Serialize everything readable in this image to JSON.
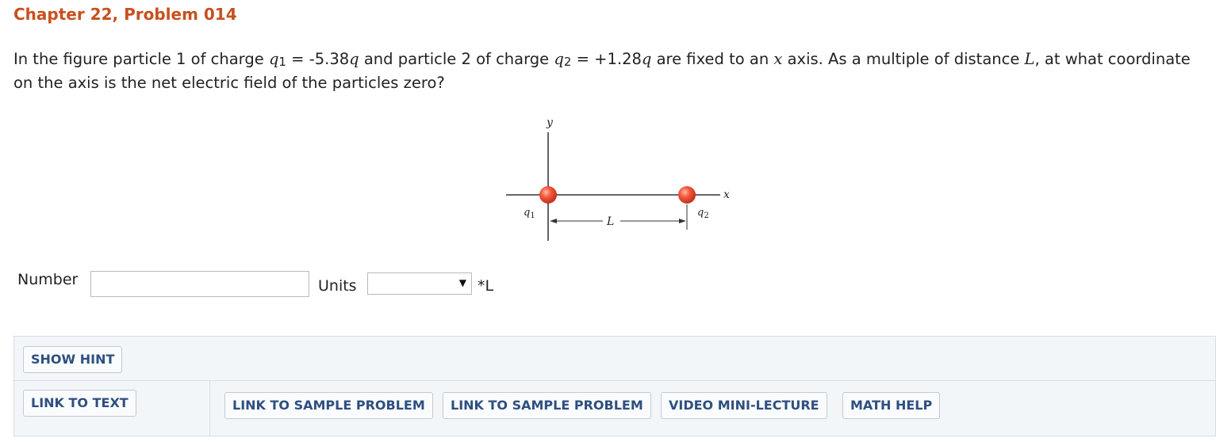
{
  "header": {
    "title": "Chapter 22, Problem 014"
  },
  "problem": {
    "part1": "In the figure particle 1 of charge ",
    "q1_var": "q",
    "q1_sub": "1",
    "q1_eq": " = -5.38",
    "q1_q": "q",
    "part2": " and particle 2 of charge ",
    "q2_var": "q",
    "q2_sub": "2",
    "q2_eq": " = +1.28",
    "q2_q": "q",
    "part3": " are fixed to an ",
    "x_var": "x",
    "part4": " axis. As a multiple of distance ",
    "L_var": "L",
    "part5": ", at what coordinate on the axis is the net electric field of the particles zero?"
  },
  "figure": {
    "y_label": "y",
    "x_label": "x",
    "q1_label": "q",
    "q1_sub": "1",
    "q2_label": "q",
    "q2_sub": "2",
    "L_label": "L",
    "particle_color": "#e8402a"
  },
  "answer": {
    "number_label": "Number",
    "number_value": "",
    "units_label": "Units",
    "units_selected": "",
    "units_suffix": "*L"
  },
  "toolbox": {
    "show_hint": "SHOW HINT",
    "link_to_text": "LINK TO TEXT",
    "sample_problem_1": "LINK TO SAMPLE PROBLEM",
    "sample_problem_2": "LINK TO SAMPLE PROBLEM",
    "video_mini_lecture": "VIDEO MINI-LECTURE",
    "math_help": "MATH HELP"
  },
  "colors": {
    "title": "#c8501e",
    "button_text": "#2e4f7f",
    "toolbox_bg": "#f3f6f9"
  }
}
